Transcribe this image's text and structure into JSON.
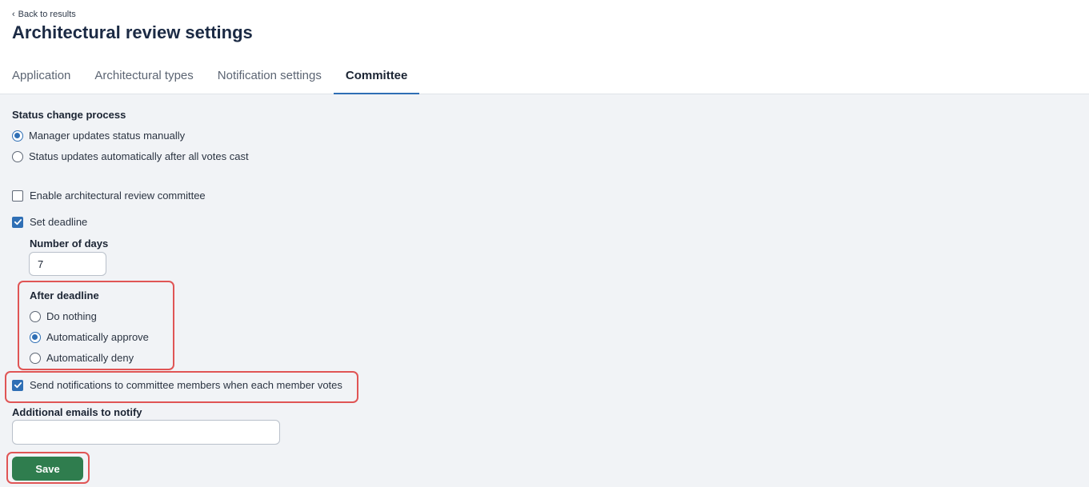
{
  "header": {
    "back_label": "Back to results",
    "title": "Architectural review settings"
  },
  "tabs": [
    {
      "label": "Application",
      "active": false
    },
    {
      "label": "Architectural types",
      "active": false
    },
    {
      "label": "Notification settings",
      "active": false
    },
    {
      "label": "Committee",
      "active": true
    }
  ],
  "status_change": {
    "label": "Status change process",
    "options": [
      {
        "label": "Manager updates status manually",
        "checked": true
      },
      {
        "label": "Status updates automatically after all votes cast",
        "checked": false
      }
    ]
  },
  "enable_committee": {
    "label": "Enable architectural review committee",
    "checked": false
  },
  "set_deadline": {
    "label": "Set deadline",
    "checked": true
  },
  "number_of_days": {
    "label": "Number of days",
    "value": "7"
  },
  "after_deadline": {
    "label": "After deadline",
    "options": [
      {
        "label": "Do nothing",
        "checked": false
      },
      {
        "label": "Automatically approve",
        "checked": true
      },
      {
        "label": "Automatically deny",
        "checked": false
      }
    ]
  },
  "send_notifications": {
    "label": "Send notifications to committee members when each member votes",
    "checked": true
  },
  "additional_emails": {
    "label": "Additional emails to notify",
    "value": ""
  },
  "save_label": "Save",
  "colors": {
    "accent": "#2f6fb5",
    "save_button": "#2f7d4e",
    "highlight": "#e05555",
    "content_bg": "#f1f3f6"
  }
}
